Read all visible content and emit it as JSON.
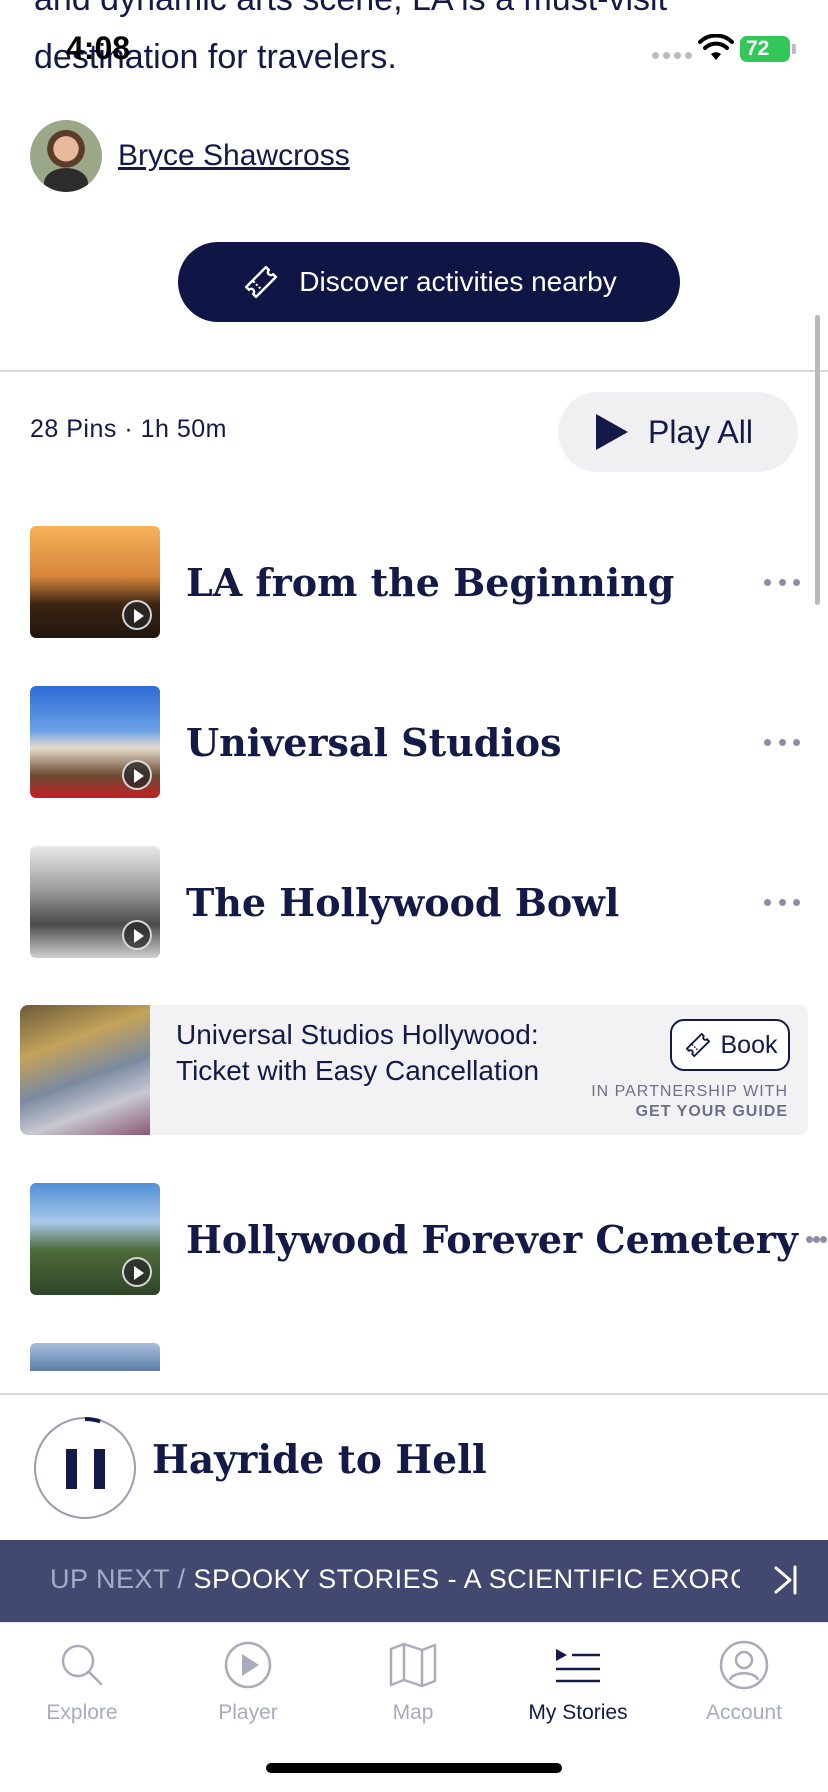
{
  "status_bar": {
    "time": "4:08",
    "battery": "72"
  },
  "intro": {
    "text": "and dynamic arts scene, LA is a must-visit destination for travelers."
  },
  "author": {
    "name": "Bryce Shawcross"
  },
  "discover_button": {
    "label": "Discover activities nearby"
  },
  "tour": {
    "meta": "28 Pins · 1h 50m",
    "play_all_label": "Play All"
  },
  "pins": [
    {
      "title": "LA from the Beginning",
      "thumb": "la-sunset-palms"
    },
    {
      "title": "Universal Studios",
      "thumb": "universal-studios-gate"
    },
    {
      "title": "The Hollywood Bowl",
      "thumb": "hollywood-bowl-bw"
    },
    {
      "title": "Hollywood Forever Cemetery",
      "thumb": "cemetery-statue"
    }
  ],
  "ad": {
    "title": "Universal Studios Hollywood: Ticket with Easy Cancellation",
    "book_label": "Book",
    "partner_line1": "IN PARTNERSHIP WITH",
    "partner_line2": "GET YOUR GUIDE"
  },
  "player": {
    "now_playing": "Hayride to Hell",
    "progress": 0.05
  },
  "up_next": {
    "label": "UP NEXT / ",
    "title": "SPOOKY STORIES - A SCIENTIFIC EXORCISM"
  },
  "tabs": [
    {
      "label": "Explore",
      "icon": "search-icon",
      "active": false
    },
    {
      "label": "Player",
      "icon": "play-circle-icon",
      "active": false
    },
    {
      "label": "Map",
      "icon": "map-icon",
      "active": false
    },
    {
      "label": "My Stories",
      "icon": "playlist-icon",
      "active": true
    },
    {
      "label": "Account",
      "icon": "user-icon",
      "active": false
    }
  ],
  "colors": {
    "navy": "#0f1645",
    "text": "#141a47",
    "up_next_bg": "#42486f",
    "inactive_tab": "#a9acbb"
  }
}
